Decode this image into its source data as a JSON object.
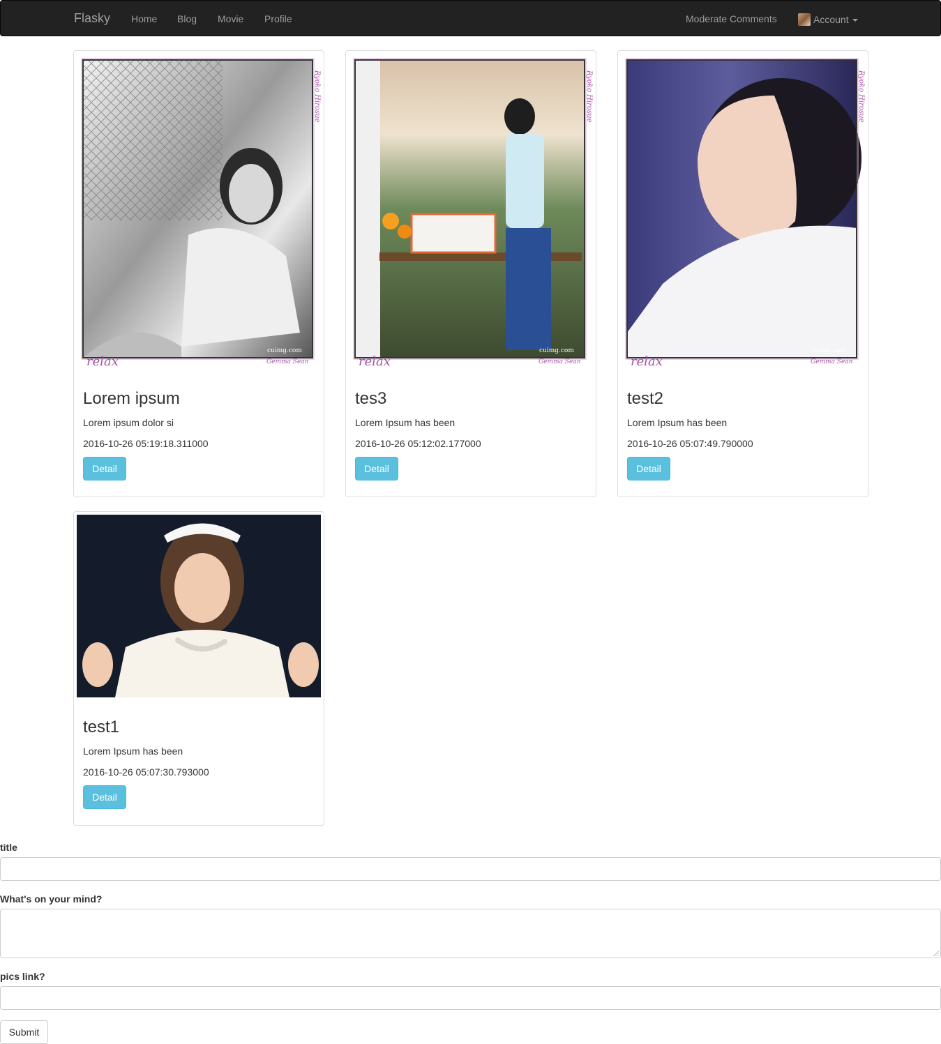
{
  "navbar": {
    "brand": "Flasky",
    "links": [
      "Home",
      "Blog",
      "Movie",
      "Profile"
    ],
    "moderate": "Moderate Comments",
    "account": "Account"
  },
  "posts": [
    {
      "title": "Lorem ipsum",
      "body": "Lorem ipsum dolor si",
      "timestamp": "2016-10-26 05:19:18.311000",
      "button": "Detail"
    },
    {
      "title": "tes3",
      "body": "Lorem Ipsum has been",
      "timestamp": "2016-10-26 05:12:02.177000",
      "button": "Detail"
    },
    {
      "title": "test2",
      "body": "Lorem Ipsum has been",
      "timestamp": "2016-10-26 05:07:49.790000",
      "button": "Detail"
    },
    {
      "title": "test1",
      "body": "Lorem Ipsum has been",
      "timestamp": "2016-10-26 05:07:30.793000",
      "button": "Detail"
    }
  ],
  "form": {
    "title_label": "title",
    "title_value": "",
    "body_label": "What's on your mind?",
    "body_value": "",
    "pic_label": "pics link?",
    "pic_value": "",
    "submit": "Submit"
  },
  "colors": {
    "navbar_bg": "#222222",
    "nav_text": "#9d9d9d",
    "detail_button": "#5bc0de",
    "frame_accent": "#a64fa6"
  }
}
